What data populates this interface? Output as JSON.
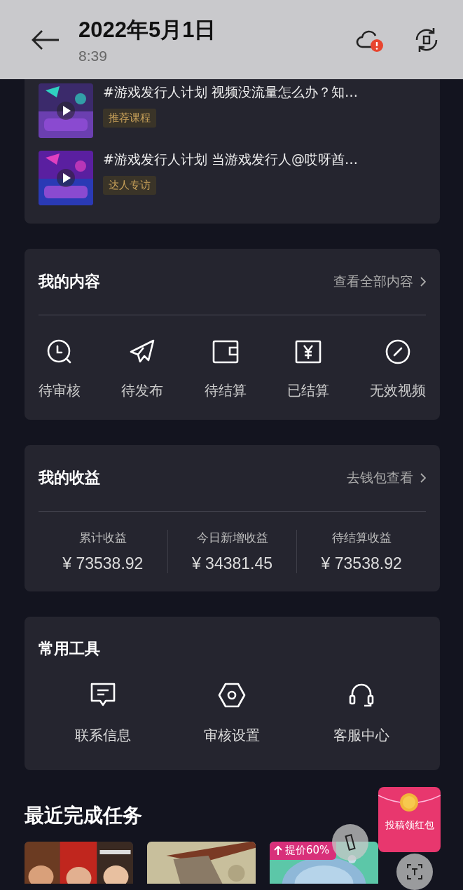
{
  "header": {
    "title": "2022年5月1日",
    "time": "8:39"
  },
  "courses": [
    {
      "title": "#游戏发行人计划 视频没流量怎么办？知…",
      "tag": "推荐课程"
    },
    {
      "title": "#游戏发行人计划 当游戏发行人@哎呀酋…",
      "tag": "达人专访"
    }
  ],
  "my_content": {
    "title": "我的内容",
    "link": "查看全部内容",
    "items": [
      {
        "label": "待审核"
      },
      {
        "label": "待发布"
      },
      {
        "label": "待结算"
      },
      {
        "label": "已结算"
      },
      {
        "label": "无效视频"
      }
    ]
  },
  "earnings": {
    "title": "我的收益",
    "link": "去钱包查看",
    "stats": [
      {
        "label": "累计收益",
        "value": "¥ 73538.92"
      },
      {
        "label": "今日新增收益",
        "value": "¥ 34381.45"
      },
      {
        "label": "待结算收益",
        "value": "¥ 73538.92"
      }
    ]
  },
  "tools": {
    "title": "常用工具",
    "items": [
      {
        "label": "联系信息"
      },
      {
        "label": "审核设置"
      },
      {
        "label": "客服中心"
      }
    ]
  },
  "recent": {
    "title": "最近完成任务",
    "tasks": [
      {
        "kind": "picture"
      },
      {
        "kind": "picture"
      },
      {
        "kind": "picture",
        "badge": "提价60%"
      }
    ]
  },
  "red_packet": {
    "label": "投稿领红包"
  }
}
